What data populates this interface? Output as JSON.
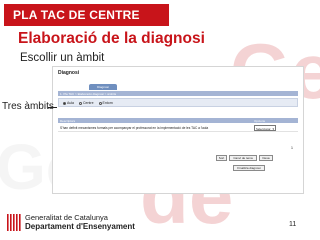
{
  "banner": {
    "label": "PLA TAC DE CENTRE"
  },
  "slide": {
    "title": "Elaboració de la diagnosi",
    "subtitle": "Escollir un àmbit"
  },
  "callout": {
    "label": "Tres àmbits"
  },
  "app": {
    "page_title": "Diagnosi",
    "tab": "Diagnosi",
    "breadcrumb": "1. Pla TAC > Elaboració diagnosi > àmbits",
    "scope_options": [
      {
        "label": "Aula",
        "selected": true
      },
      {
        "label": "Centre",
        "selected": false
      },
      {
        "label": "Entorn",
        "selected": false
      }
    ],
    "table": {
      "headers": [
        "Descriptors",
        "Opcions"
      ],
      "row": {
        "descriptor": "S'han definit mecanismes formals per acompanyar el professorat en la implementació de les TAC a l'aula",
        "option_value": "Seleccionar"
      }
    },
    "pagination": "1",
    "buttons": {
      "sort": "Sort",
      "change_descriptors": "Canvi de tema",
      "save": "Desa",
      "finish": "Finalitza diagnosi"
    }
  },
  "footer": {
    "org": "Generalitat de Catalunya",
    "department": "Departament d'Ensenyament",
    "page_number": "11"
  },
  "colors": {
    "brand_red": "#c8141a",
    "app_header_blue": "#a4b4d4",
    "tab_blue": "#6f8fbf"
  }
}
